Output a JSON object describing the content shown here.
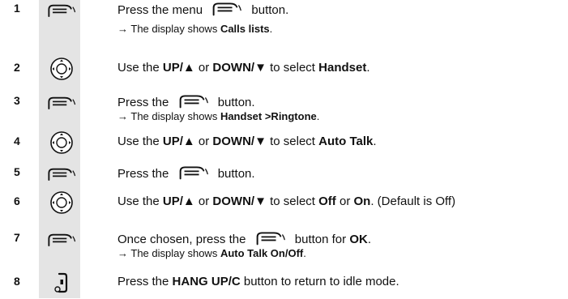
{
  "steps": [
    {
      "num": "1",
      "icon": "menu-key-icon",
      "line1": [
        {
          "t": "Press the menu "
        },
        {
          "icon": "menu-key-icon"
        },
        {
          "t": " button."
        }
      ],
      "line2": [
        {
          "t": "→ The display shows "
        },
        {
          "t": "Calls lists",
          "b": true
        },
        {
          "t": "."
        }
      ],
      "gap": true
    },
    {
      "num": "2",
      "icon": "navigation-key-icon",
      "line1": [
        {
          "t": "Use the "
        },
        {
          "t": "UP/▲",
          "b": true
        },
        {
          "t": " or "
        },
        {
          "t": "DOWN/▼",
          "b": true
        },
        {
          "t": " to select "
        },
        {
          "t": "Handset",
          "b": true
        },
        {
          "t": "."
        }
      ]
    },
    {
      "num": "3",
      "icon": "menu-key-icon",
      "line1": [
        {
          "t": "Press the "
        },
        {
          "icon": "menu-key-icon"
        },
        {
          "t": " button."
        }
      ],
      "line2": [
        {
          "t": "→ The display shows "
        },
        {
          "t": "Handset >Ringtone",
          "b": true
        },
        {
          "t": "."
        }
      ]
    },
    {
      "num": "4",
      "icon": "navigation-key-icon",
      "line1": [
        {
          "t": "Use the "
        },
        {
          "t": "UP/▲",
          "b": true
        },
        {
          "t": " or "
        },
        {
          "t": "DOWN/▼",
          "b": true
        },
        {
          "t": " to select "
        },
        {
          "t": "Auto Talk",
          "b": true
        },
        {
          "t": "."
        }
      ]
    },
    {
      "num": "5",
      "icon": "menu-key-icon",
      "line1": [
        {
          "t": "Press the "
        },
        {
          "icon": "menu-key-icon"
        },
        {
          "t": " button."
        }
      ]
    },
    {
      "num": "6",
      "icon": "navigation-key-icon",
      "line1": [
        {
          "t": "Use the "
        },
        {
          "t": "UP/▲",
          "b": true
        },
        {
          "t": " or "
        },
        {
          "t": "DOWN/▼",
          "b": true
        },
        {
          "t": " to select "
        },
        {
          "t": "Off",
          "b": true
        },
        {
          "t": " or "
        },
        {
          "t": "On",
          "b": true
        },
        {
          "t": ". (Default is Off)"
        }
      ]
    },
    {
      "num": "7",
      "icon": "menu-key-icon",
      "line1": [
        {
          "t": "Once chosen, press the "
        },
        {
          "icon": "menu-key-icon"
        },
        {
          "t": " button for "
        },
        {
          "t": "OK",
          "b": true
        },
        {
          "t": "."
        }
      ],
      "line2": [
        {
          "t": "→ The display shows "
        },
        {
          "t": "Auto Talk On/Off",
          "b": true
        },
        {
          "t": "."
        }
      ]
    },
    {
      "num": "8",
      "icon": "hang-up-key-icon",
      "line1": [
        {
          "t": "Press the "
        },
        {
          "t": "HANG UP/C",
          "b": true
        },
        {
          "t": " button to return to idle mode."
        }
      ]
    }
  ]
}
